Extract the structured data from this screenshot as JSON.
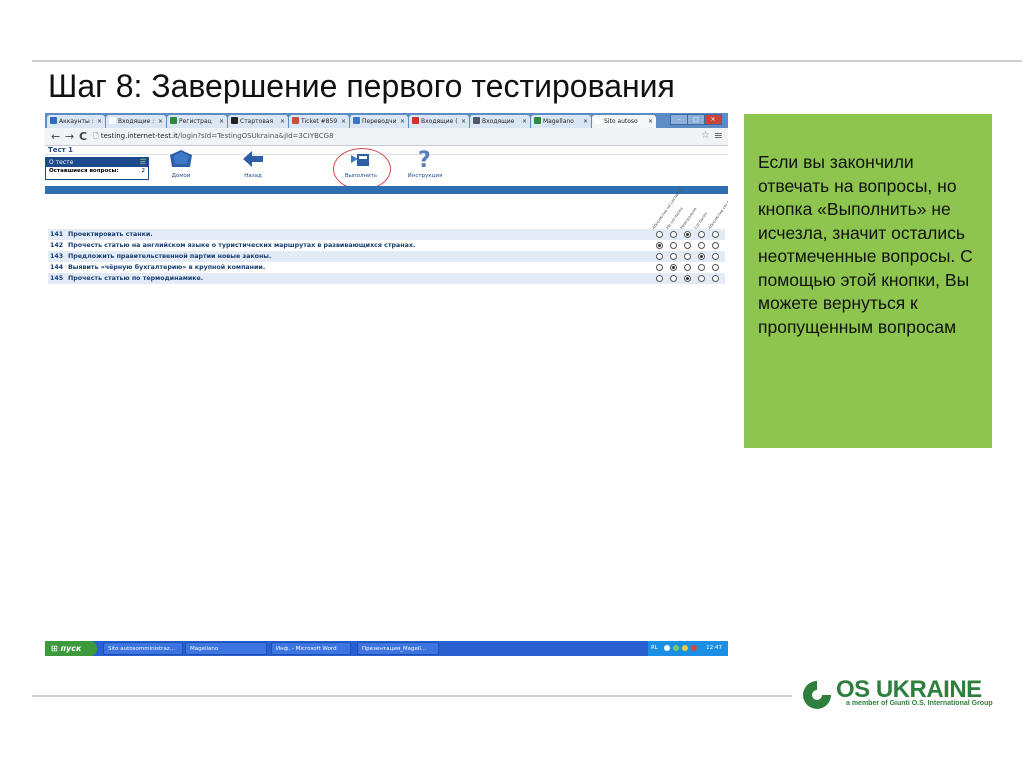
{
  "slide": {
    "title": "Шаг 8: Завершение первого тестирования",
    "callout": "Если вы закончили отвечать на вопросы, но кнопка «Выполнить» не исчезла, значит остались неотмеченные вопросы. С помощью этой кнопки, Вы можете вернуться к пропущенным вопросам",
    "logo": {
      "name": "OS UKRAINE",
      "tagline": "a member of Giunti O.S. International Group"
    }
  },
  "browser": {
    "tabs": [
      {
        "label": "Аккаунты :",
        "color": "#2f6bbd"
      },
      {
        "label": "Входящие :",
        "color": "#ffffff"
      },
      {
        "label": "Регистрац",
        "color": "#2c8a3b"
      },
      {
        "label": "Стартовая",
        "color": "#222222"
      },
      {
        "label": "Ticket #859",
        "color": "#d34b3a"
      },
      {
        "label": "Переводчи",
        "color": "#3a78c9"
      },
      {
        "label": "Входящие (",
        "color": "#d93025"
      },
      {
        "label": "Входящие",
        "color": "#4a5a6b"
      },
      {
        "label": "Magellano",
        "color": "#2c8a3b"
      },
      {
        "label": "Sito autoso",
        "color": "#ffffff"
      }
    ],
    "url_host": "testing.internet-test.it",
    "url_path": "/login?sId=TestingOSUkraina&jId=3CIYBCG8"
  },
  "app": {
    "test_name": "Тест 1",
    "info_header": "О тесте",
    "remaining_label": "Оставшиеся вопросы:",
    "remaining_value": "2",
    "toolbar": {
      "home": "Домой",
      "back": "Назад",
      "submit": "Выполнить",
      "help": "Инструкция"
    },
    "answer_headers": [
      "Абсолютно не согласен",
      "Не согласен",
      "Нейтрально",
      "Согласен",
      "Абсолютно согласен"
    ],
    "questions": [
      {
        "num": "141",
        "text": "Проектировать станки.",
        "selected": 2
      },
      {
        "num": "142",
        "text": "Прочесть статью на английском языке о туристических маршрутах в развивающихся странах.",
        "selected": 0
      },
      {
        "num": "143",
        "text": "Предложить правительственной партии новые законы.",
        "selected": 3
      },
      {
        "num": "144",
        "text": "Выявить «чёрную бухгалтерию» в крупной компании.",
        "selected": 1
      },
      {
        "num": "145",
        "text": "Прочесть статью по термодинамике.",
        "selected": 2
      }
    ]
  },
  "taskbar": {
    "start": "пуск",
    "tasks": [
      "Sito autosomministraz...",
      "Magellano",
      "Инф. - Microsoft Word",
      "Презентация_Magell..."
    ],
    "lang": "RL",
    "clock": "12:47"
  }
}
